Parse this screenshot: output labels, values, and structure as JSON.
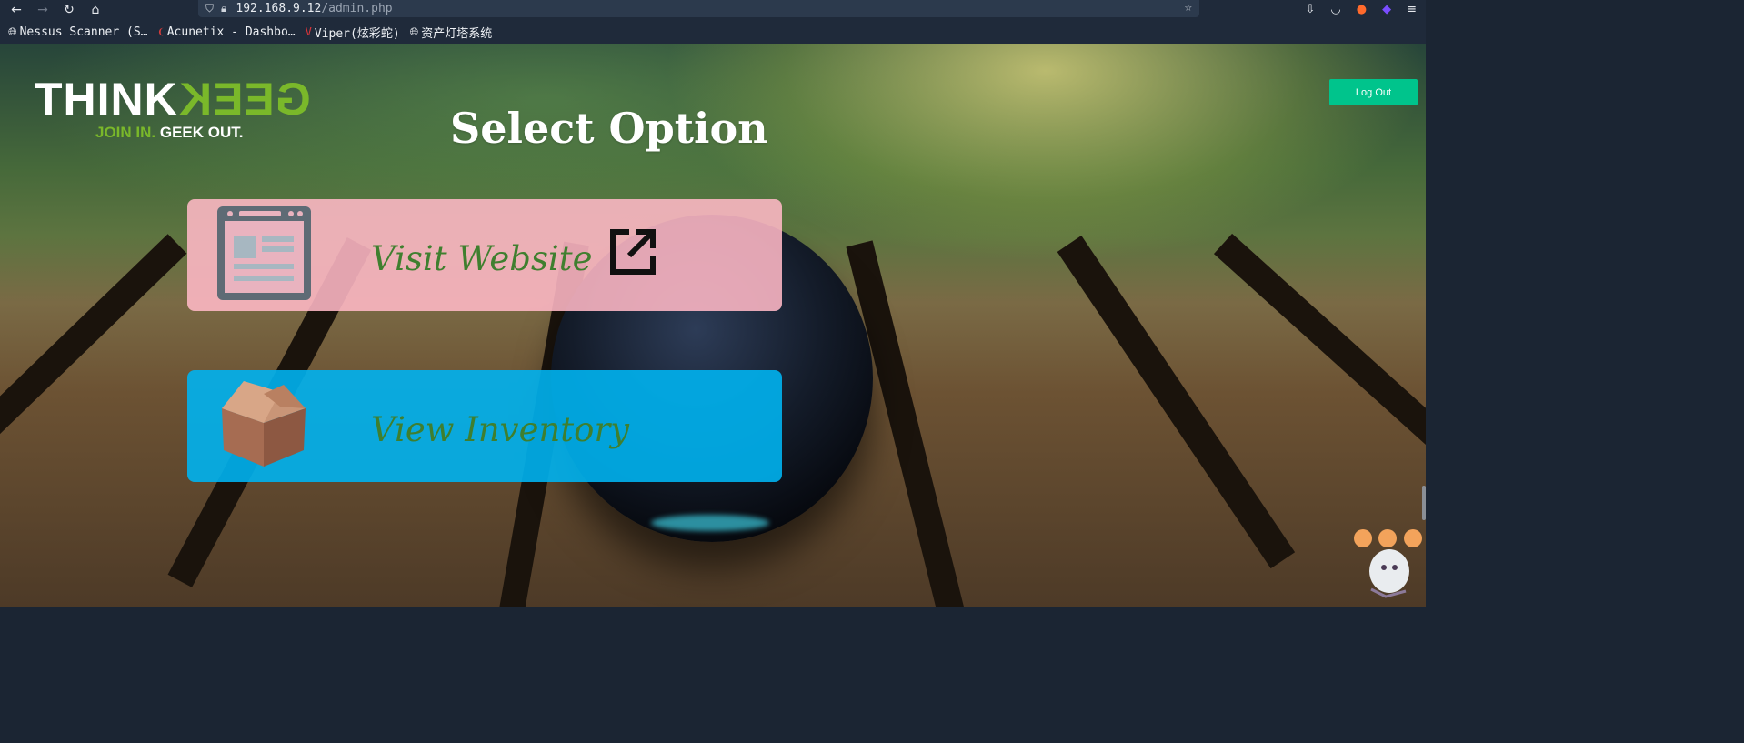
{
  "browser": {
    "url_host": "192.168.9.12",
    "url_path": "/admin.php",
    "icons": {
      "back": "back-arrow-icon",
      "forward": "forward-arrow-icon",
      "reload": "reload-icon",
      "home": "home-icon",
      "shield": "shield-icon",
      "lock": "lock-icon",
      "star": "star-icon"
    },
    "bookmarks": [
      {
        "label": "Nessus Scanner (S…",
        "icon": "globe-icon"
      },
      {
        "label": "Acunetix - Dashbo…",
        "icon": "acunetix-icon"
      },
      {
        "label": "Viper(炫彩蛇)",
        "icon": "viper-icon"
      },
      {
        "label": "资产灯塔系统",
        "icon": "globe-icon"
      }
    ]
  },
  "page": {
    "logo": {
      "think": "THINK",
      "geek": "GEEK",
      "tagline_a": "JOIN IN.",
      "tagline_b": "GEEK OUT."
    },
    "title": "Select Option",
    "logout_label": "Log Out",
    "options": [
      {
        "label": "Visit Website",
        "icon": "web-page-icon",
        "action_icon": "external-link-icon",
        "color": "#ffb8c6"
      },
      {
        "label": "View Inventory",
        "icon": "package-box-icon",
        "color": "#00b2f0"
      }
    ],
    "accent_green": "#7ab82a",
    "button_color": "#00c48c"
  }
}
